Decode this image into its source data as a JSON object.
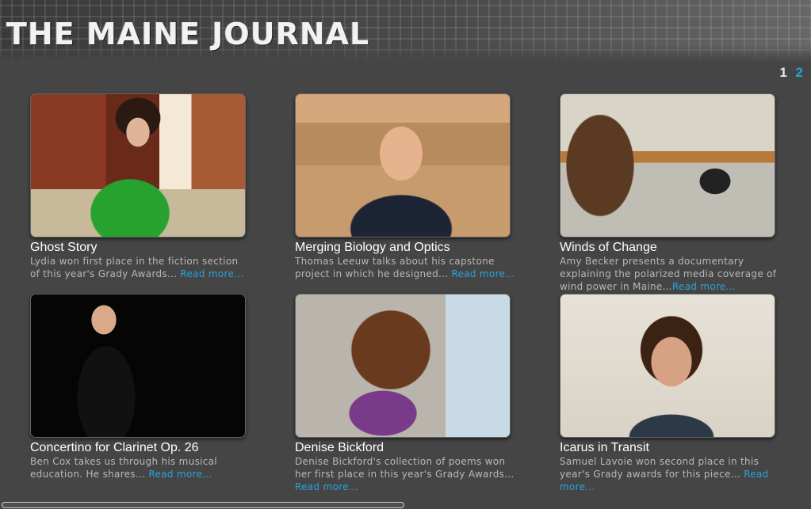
{
  "site": {
    "logo": "THE MAINE JOURNAL"
  },
  "pager": {
    "pages": [
      "1",
      "2"
    ],
    "current": "2"
  },
  "read_more_label": "Read more...",
  "articles": [
    {
      "title": "Ghost Story",
      "desc": "Lydia won first place in the fiction section of this year's Grady Awards... ",
      "read_more": "Read more..."
    },
    {
      "title": "Merging Biology and Optics",
      "desc": "Thomas Leeuw talks about his capstone project in which he designed... ",
      "read_more": "Read more..."
    },
    {
      "title": "Winds of Change",
      "desc": "Amy Becker presents a documentary explaining the polarized media coverage of wind power in Maine...",
      "read_more": "Read more..."
    },
    {
      "title": "Concertino for Clarinet Op. 26",
      "desc": "Ben Cox takes us through his musical education. He shares... ",
      "read_more": "Read more..."
    },
    {
      "title": "Denise Bickford",
      "desc": "Denise Bickford's collection of poems won her first place in this year's Grady Awards... ",
      "read_more": "Read more..."
    },
    {
      "title": "Icarus in Transit",
      "desc": "Samuel Lavoie won second place in this year's Grady awards for this piece... ",
      "read_more": "Read more..."
    }
  ],
  "colors": {
    "accent": "#29a3dc",
    "background": "#454545",
    "title": "#ffffff",
    "description": "#b8b8b8"
  }
}
